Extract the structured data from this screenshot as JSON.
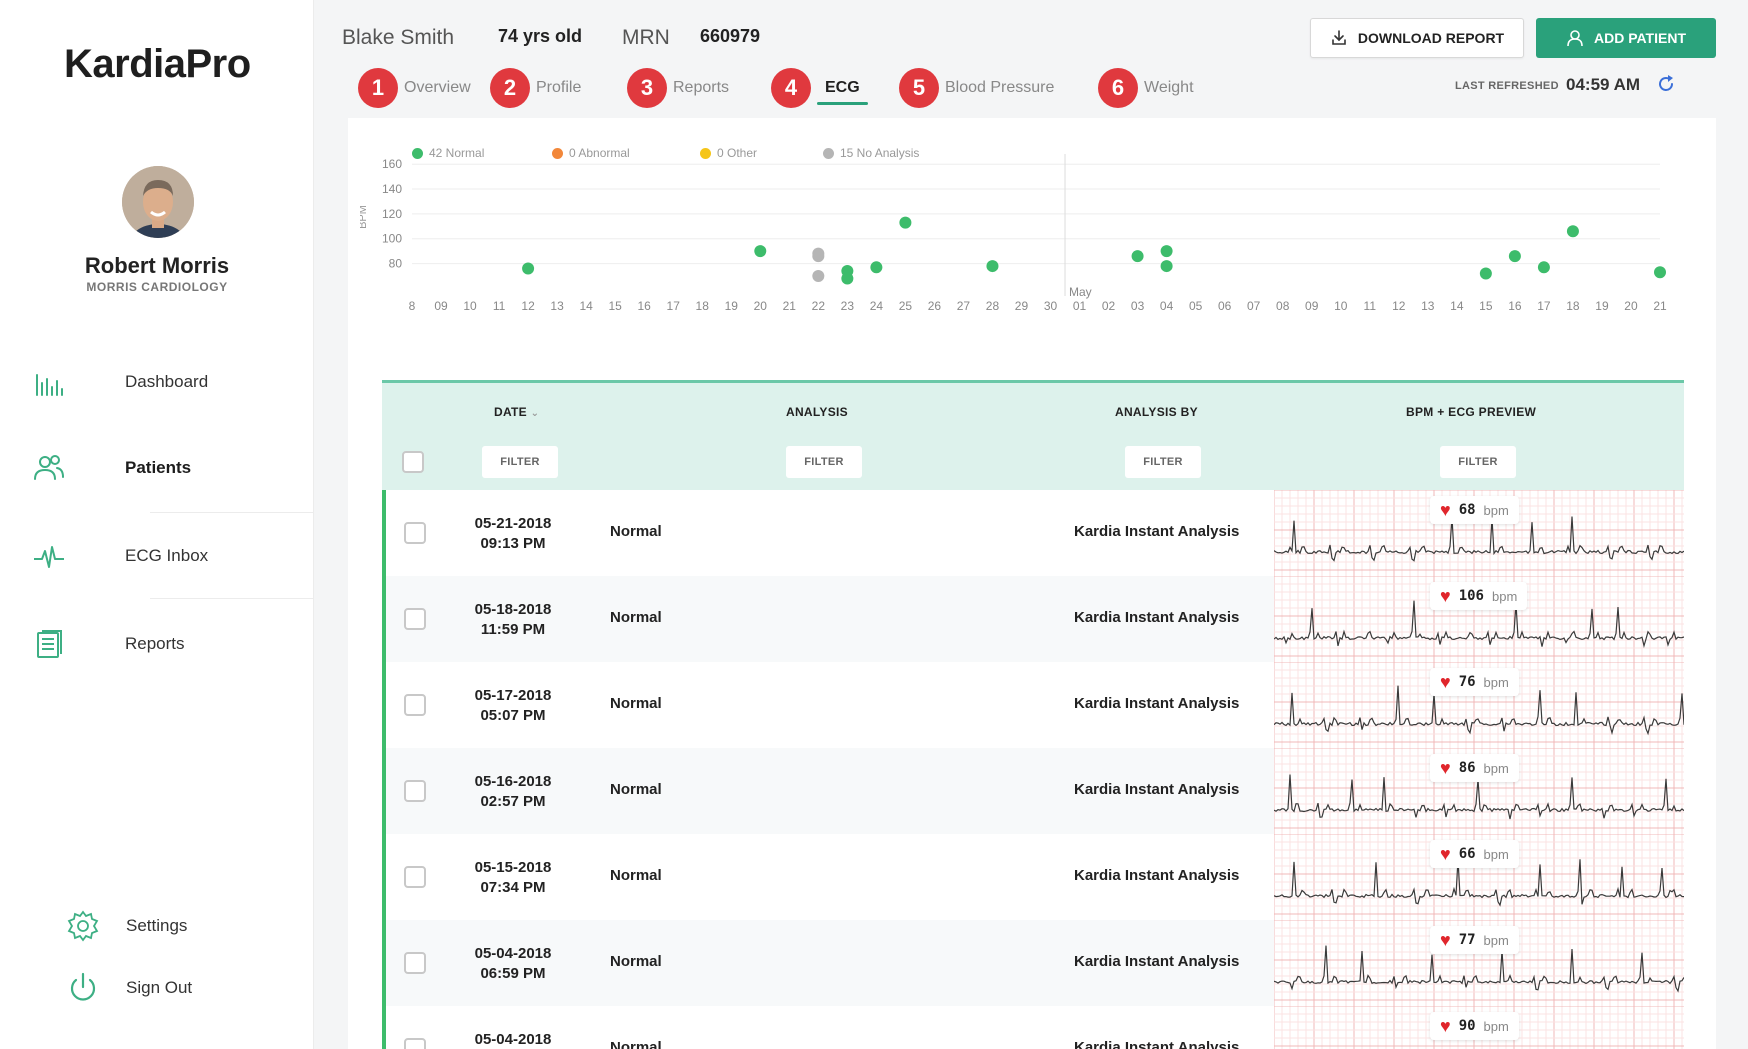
{
  "app": {
    "logo": "KardiaPro"
  },
  "doctor": {
    "name": "Robert Morris",
    "clinic": "MORRIS CARDIOLOGY"
  },
  "sidebar": {
    "items": [
      {
        "label": "Dashboard",
        "icon": "bar-chart-icon"
      },
      {
        "label": "Patients",
        "icon": "users-icon",
        "active": true
      },
      {
        "label": "ECG Inbox",
        "icon": "pulse-icon"
      },
      {
        "label": "Reports",
        "icon": "document-icon"
      }
    ],
    "settings_label": "Settings",
    "signout_label": "Sign Out"
  },
  "patient": {
    "name": "Blake Smith",
    "age": "74 yrs old",
    "mrn_label": "MRN",
    "mrn": "660979"
  },
  "actions": {
    "download_label": "DOWNLOAD REPORT",
    "add_label": "ADD PATIENT"
  },
  "tabs": [
    {
      "badge": "1",
      "label": "Overview"
    },
    {
      "badge": "2",
      "label": "Profile"
    },
    {
      "badge": "3",
      "label": "Reports"
    },
    {
      "badge": "4",
      "label": "ECG",
      "active": true
    },
    {
      "badge": "5",
      "label": "Blood Pressure"
    },
    {
      "badge": "6",
      "label": "Weight"
    }
  ],
  "refresh": {
    "label": "LAST REFRESHED",
    "time": "04:59 AM"
  },
  "legend": [
    {
      "label": "42 Normal",
      "color": "#3dbc6b"
    },
    {
      "label": "0 Abnormal",
      "color": "#f2873a"
    },
    {
      "label": "0 Other",
      "color": "#f5c518"
    },
    {
      "label": "15 No Analysis",
      "color": "#b5b5b5"
    }
  ],
  "chart_data": {
    "type": "scatter",
    "ylabel": "BPM",
    "yticks": [
      80,
      100,
      120,
      140,
      160
    ],
    "ylim": [
      70,
      165
    ],
    "month_marker": "May",
    "x_labels": [
      "8",
      "09",
      "10",
      "11",
      "12",
      "13",
      "14",
      "15",
      "16",
      "17",
      "18",
      "19",
      "20",
      "21",
      "22",
      "23",
      "24",
      "25",
      "26",
      "27",
      "28",
      "29",
      "30",
      "01",
      "02",
      "03",
      "04",
      "05",
      "06",
      "07",
      "08",
      "09",
      "10",
      "11",
      "12",
      "13",
      "14",
      "15",
      "16",
      "17",
      "18",
      "19",
      "20",
      "21"
    ],
    "series": [
      {
        "color": "#3dbc6b",
        "points": [
          {
            "x": "12",
            "y": 76
          },
          {
            "x": "20",
            "y": 90
          },
          {
            "x": "23",
            "y": 74
          },
          {
            "x": "23",
            "y": 68
          },
          {
            "x": "24",
            "y": 77
          },
          {
            "x": "25",
            "y": 113
          },
          {
            "x": "28",
            "y": 78
          },
          {
            "x": "03",
            "y": 86
          },
          {
            "x": "04",
            "y": 90
          },
          {
            "x": "04",
            "y": 78
          },
          {
            "x": "15",
            "y": 72
          },
          {
            "x": "16",
            "y": 86
          },
          {
            "x": "17",
            "y": 77
          },
          {
            "x": "18",
            "y": 106
          },
          {
            "x": "21",
            "y": 73
          }
        ]
      },
      {
        "color": "#b5b5b5",
        "points": [
          {
            "x": "22",
            "y": 86
          },
          {
            "x": "22",
            "y": 88
          },
          {
            "x": "22",
            "y": 70
          }
        ]
      }
    ]
  },
  "table": {
    "headers": {
      "date": "DATE",
      "analysis": "ANALYSIS",
      "by": "ANALYSIS BY",
      "preview": "BPM + ECG PREVIEW"
    },
    "filter_label": "FILTER",
    "bpm_unit": "bpm",
    "rows": [
      {
        "date": "05-21-2018",
        "time": "09:13 PM",
        "analysis": "Normal",
        "by": "Kardia Instant Analysis",
        "bpm": "68"
      },
      {
        "date": "05-18-2018",
        "time": "11:59 PM",
        "analysis": "Normal",
        "by": "Kardia Instant Analysis",
        "bpm": "106"
      },
      {
        "date": "05-17-2018",
        "time": "05:07 PM",
        "analysis": "Normal",
        "by": "Kardia Instant Analysis",
        "bpm": "76"
      },
      {
        "date": "05-16-2018",
        "time": "02:57 PM",
        "analysis": "Normal",
        "by": "Kardia Instant Analysis",
        "bpm": "86"
      },
      {
        "date": "05-15-2018",
        "time": "07:34 PM",
        "analysis": "Normal",
        "by": "Kardia Instant Analysis",
        "bpm": "66"
      },
      {
        "date": "05-04-2018",
        "time": "06:59 PM",
        "analysis": "Normal",
        "by": "Kardia Instant Analysis",
        "bpm": "77"
      },
      {
        "date": "05-04-2018",
        "time": "",
        "analysis": "Normal",
        "by": "Kardia Instant Analysis",
        "bpm": "90"
      }
    ]
  }
}
